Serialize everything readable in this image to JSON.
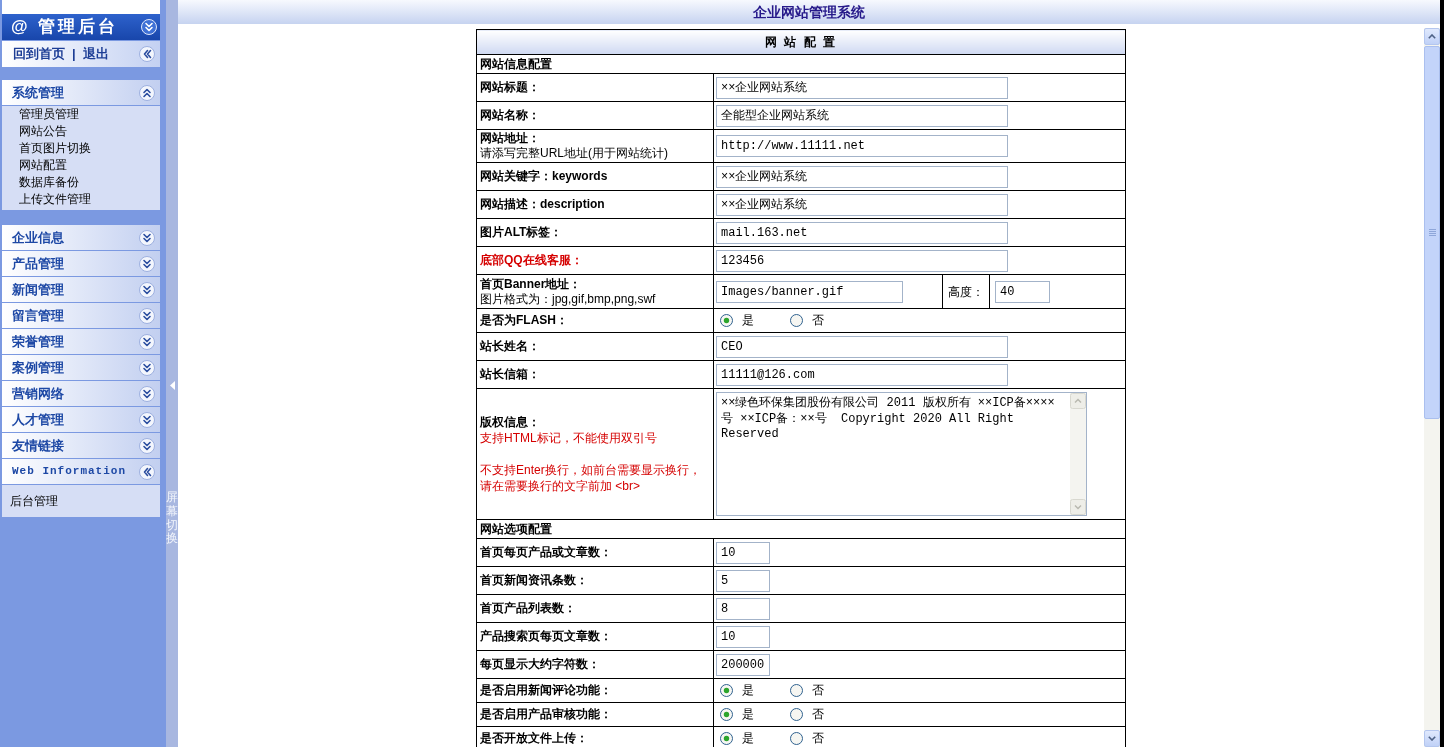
{
  "sidebar": {
    "title": "@ 管理后台",
    "links": [
      "回到首页",
      "退出"
    ],
    "link_separator": "|",
    "sections": [
      {
        "kind": "menu",
        "title": "系统管理",
        "expanded": true,
        "items": [
          "管理员管理",
          "网站公告",
          "首页图片切换",
          "网站配置",
          "数据库备份",
          "上传文件管理"
        ]
      },
      {
        "kind": "menu",
        "title": "企业信息",
        "expanded": false
      },
      {
        "kind": "menu",
        "title": "产品管理",
        "expanded": false
      },
      {
        "kind": "menu",
        "title": "新闻管理",
        "expanded": false
      },
      {
        "kind": "menu",
        "title": "留言管理",
        "expanded": false
      },
      {
        "kind": "menu",
        "title": "荣誉管理",
        "expanded": false
      },
      {
        "kind": "menu",
        "title": "案例管理",
        "expanded": false
      },
      {
        "kind": "menu",
        "title": "营销网络",
        "expanded": false
      },
      {
        "kind": "menu",
        "title": "人才管理",
        "expanded": false
      },
      {
        "kind": "menu",
        "title": "友情链接",
        "expanded": false
      },
      {
        "kind": "panel",
        "title": "Web Information",
        "expanded": true,
        "items": [
          "后台管理"
        ]
      }
    ]
  },
  "splitter": {
    "label": "屏幕切换"
  },
  "header": {
    "title": "企业网站管理系统"
  },
  "form": {
    "title": "网 站 配 置",
    "rows": [
      {
        "kind": "section",
        "label": "网站信息配置",
        "highlighted": false
      },
      {
        "kind": "text",
        "label": "网站标题：",
        "value": "××企业网站系统",
        "highlighted": false
      },
      {
        "kind": "text",
        "label": "网站名称：",
        "value": "全能型企业网站系统",
        "highlighted": false
      },
      {
        "kind": "text",
        "label": "网站地址：",
        "note": "请添写完整URL地址(用于网站统计)",
        "value": "http://www.11111.net",
        "highlighted": false
      },
      {
        "kind": "text",
        "label": "网站关键字：keywords",
        "value": "××企业网站系统",
        "highlighted": false
      },
      {
        "kind": "text",
        "label": "网站描述：description",
        "value": "××企业网站系统",
        "highlighted": false
      },
      {
        "kind": "text",
        "label": "图片ALT标签：",
        "value": "mail.163.net",
        "highlighted": false
      },
      {
        "kind": "text",
        "label": "底部QQ在线客服：",
        "value": "123456",
        "highlighted": true
      },
      {
        "kind": "banner",
        "label": "首页Banner地址：",
        "note": "图片格式为：jpg,gif,bmp,png,swf",
        "value": "Images/banner.gif",
        "height_label": "高度：",
        "height_value": "40",
        "highlighted": false
      },
      {
        "kind": "radio",
        "label": "是否为FLASH：",
        "options": [
          {
            "label": "是",
            "selected": true
          },
          {
            "label": "否",
            "selected": false
          }
        ],
        "highlighted": false
      },
      {
        "kind": "text",
        "label": "站长姓名：",
        "value": "CEO",
        "highlighted": false
      },
      {
        "kind": "text",
        "label": "站长信箱：",
        "value": "11111@126.com",
        "highlighted": false
      },
      {
        "kind": "textarea",
        "label": "版权信息：",
        "warnings": [
          "支持HTML标记，不能使用双引号",
          "不支持Enter换行，如前台需要显示换行，请在需要换行的文字前加 <br>"
        ],
        "value": "××绿色环保集团股份有限公司 2011 版权所有 ××ICP备××××号 ××ICP备：××号  Copyright 2020 All Right Reserved",
        "highlighted": false
      },
      {
        "kind": "section",
        "label": "网站选项配置",
        "highlighted": false
      },
      {
        "kind": "number",
        "label": "首页每页产品或文章数：",
        "value": "10",
        "highlighted": false
      },
      {
        "kind": "number",
        "label": "首页新闻资讯条数：",
        "value": "5",
        "highlighted": false
      },
      {
        "kind": "number",
        "label": "首页产品列表数：",
        "value": "8",
        "highlighted": false
      },
      {
        "kind": "number",
        "label": "产品搜索页每页文章数：",
        "value": "10",
        "highlighted": false
      },
      {
        "kind": "number",
        "label": "每页显示大约字符数：",
        "value": "200000",
        "highlighted": false
      },
      {
        "kind": "radio",
        "label": "是否启用新闻评论功能：",
        "options": [
          {
            "label": "是",
            "selected": true
          },
          {
            "label": "否",
            "selected": false
          }
        ],
        "highlighted": false
      },
      {
        "kind": "radio",
        "label": "是否启用产品审核功能：",
        "options": [
          {
            "label": "是",
            "selected": true
          },
          {
            "label": "否",
            "selected": false
          }
        ],
        "highlighted": false
      },
      {
        "kind": "radio",
        "label": "是否开放文件上传：",
        "options": [
          {
            "label": "是",
            "selected": true
          },
          {
            "label": "否",
            "selected": false
          }
        ],
        "highlighted": false
      }
    ]
  }
}
